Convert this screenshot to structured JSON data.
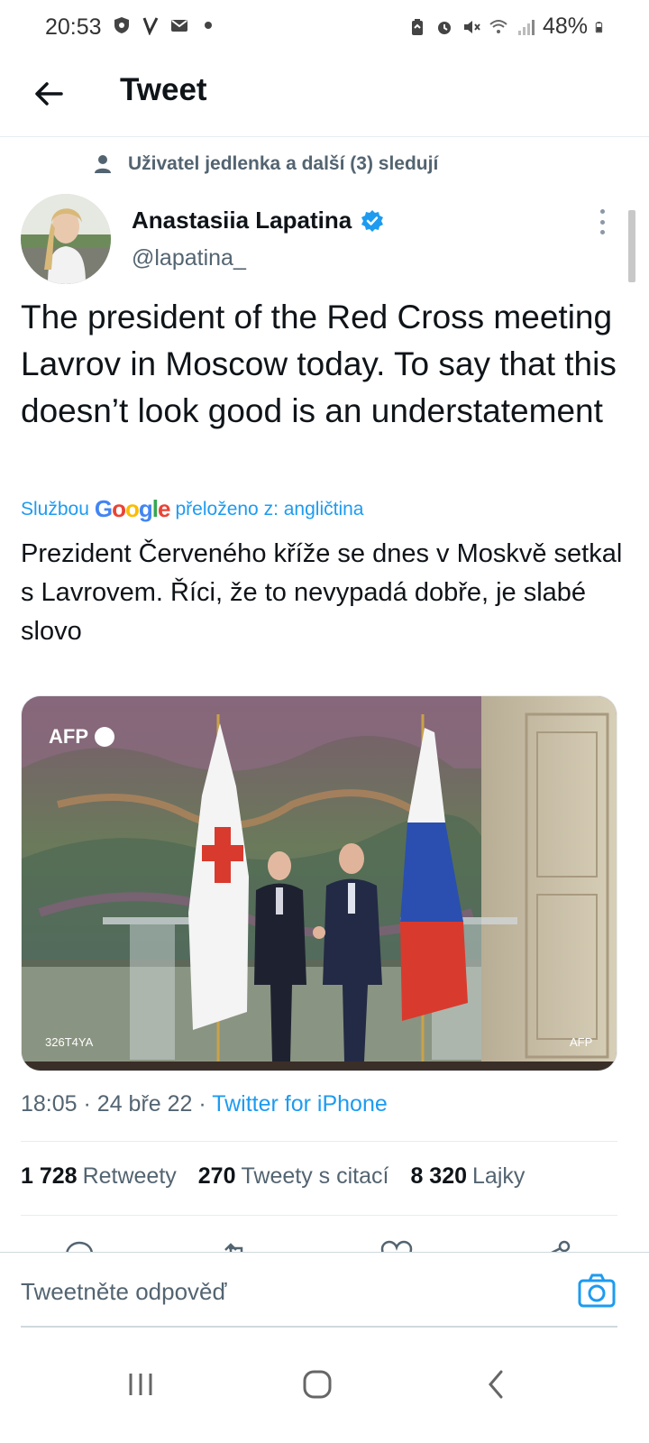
{
  "status_bar": {
    "time": "20:53",
    "battery": "48%"
  },
  "header": {
    "title": "Tweet"
  },
  "social_context": "Uživatel jedlenka a další (3) sledují",
  "author": {
    "name": "Anastasiia Lapatina",
    "handle": "@lapatina_",
    "verified": true
  },
  "tweet": {
    "text": "The president of the Red Cross meeting Lavrov in Moscow today. To say that this doesn’t look good is an understatement",
    "translated_prefix": "Službou",
    "translated_suffix": "přeloženo z: angličtina",
    "translation": "Prezident Červeného kříže se dnes v Moskvě setkal s Lavrovem. Říci, že to nevypadá dobře, je slabé slovo",
    "media": {
      "watermark": "AFP",
      "photo_id": "326T4YA",
      "credit": "AFP"
    },
    "time": "18:05",
    "date": "24 bře 22",
    "separator": "·",
    "source": "Twitter for iPhone"
  },
  "stats": {
    "retweets_count": "1 728",
    "retweets_label": "Retweety",
    "quotes_count": "270",
    "quotes_label": "Tweety s citací",
    "likes_count": "8 320",
    "likes_label": "Lajky"
  },
  "reply": {
    "placeholder": "Tweetněte odpověď"
  },
  "colors": {
    "accent": "#1d9bf0",
    "text_primary": "#0f1419",
    "text_secondary": "#536471"
  }
}
